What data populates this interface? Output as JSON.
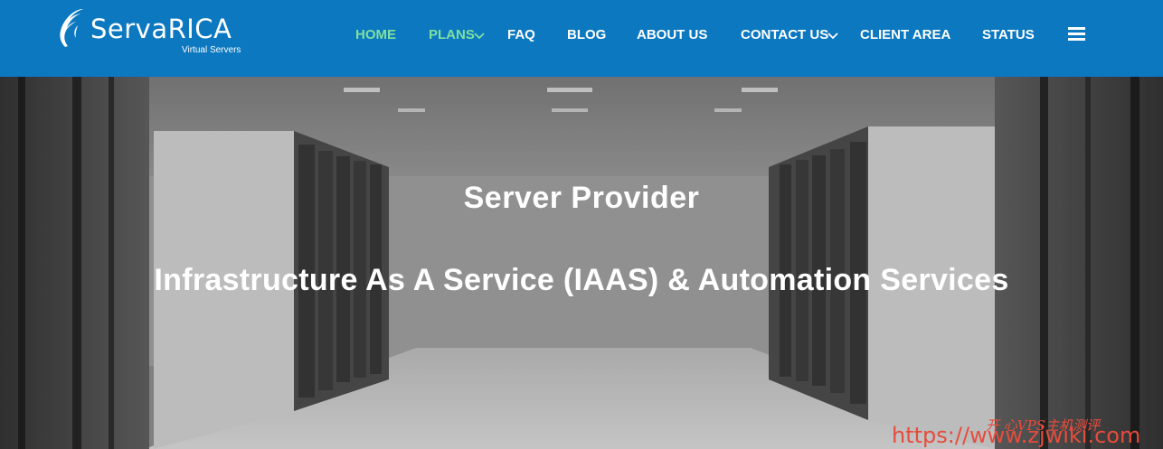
{
  "brand": {
    "name": "ServaRICA",
    "tagline": "Virtual Servers"
  },
  "nav": {
    "items": [
      {
        "label": "HOME",
        "active": true
      },
      {
        "label": "PLANS",
        "active": true,
        "dropdown": true
      },
      {
        "label": "FAQ"
      },
      {
        "label": "BLOG"
      },
      {
        "label": "ABOUT US"
      },
      {
        "label": "CONTACT US",
        "dropdown": true
      },
      {
        "label": "CLIENT AREA"
      },
      {
        "label": "STATUS"
      }
    ],
    "menu_icon": "hamburger-menu-icon"
  },
  "hero": {
    "title": "Server Provider",
    "subtitle": "Infrastructure As A Service (IAAS) & Automation Services"
  },
  "watermark": {
    "url": "https://www.zjwiki.com",
    "cn": "开 心VPS主机测评"
  },
  "colors": {
    "navbar": "#0b78c0",
    "active_nav": "#7fe0a0",
    "watermark": "#e74c3c"
  }
}
